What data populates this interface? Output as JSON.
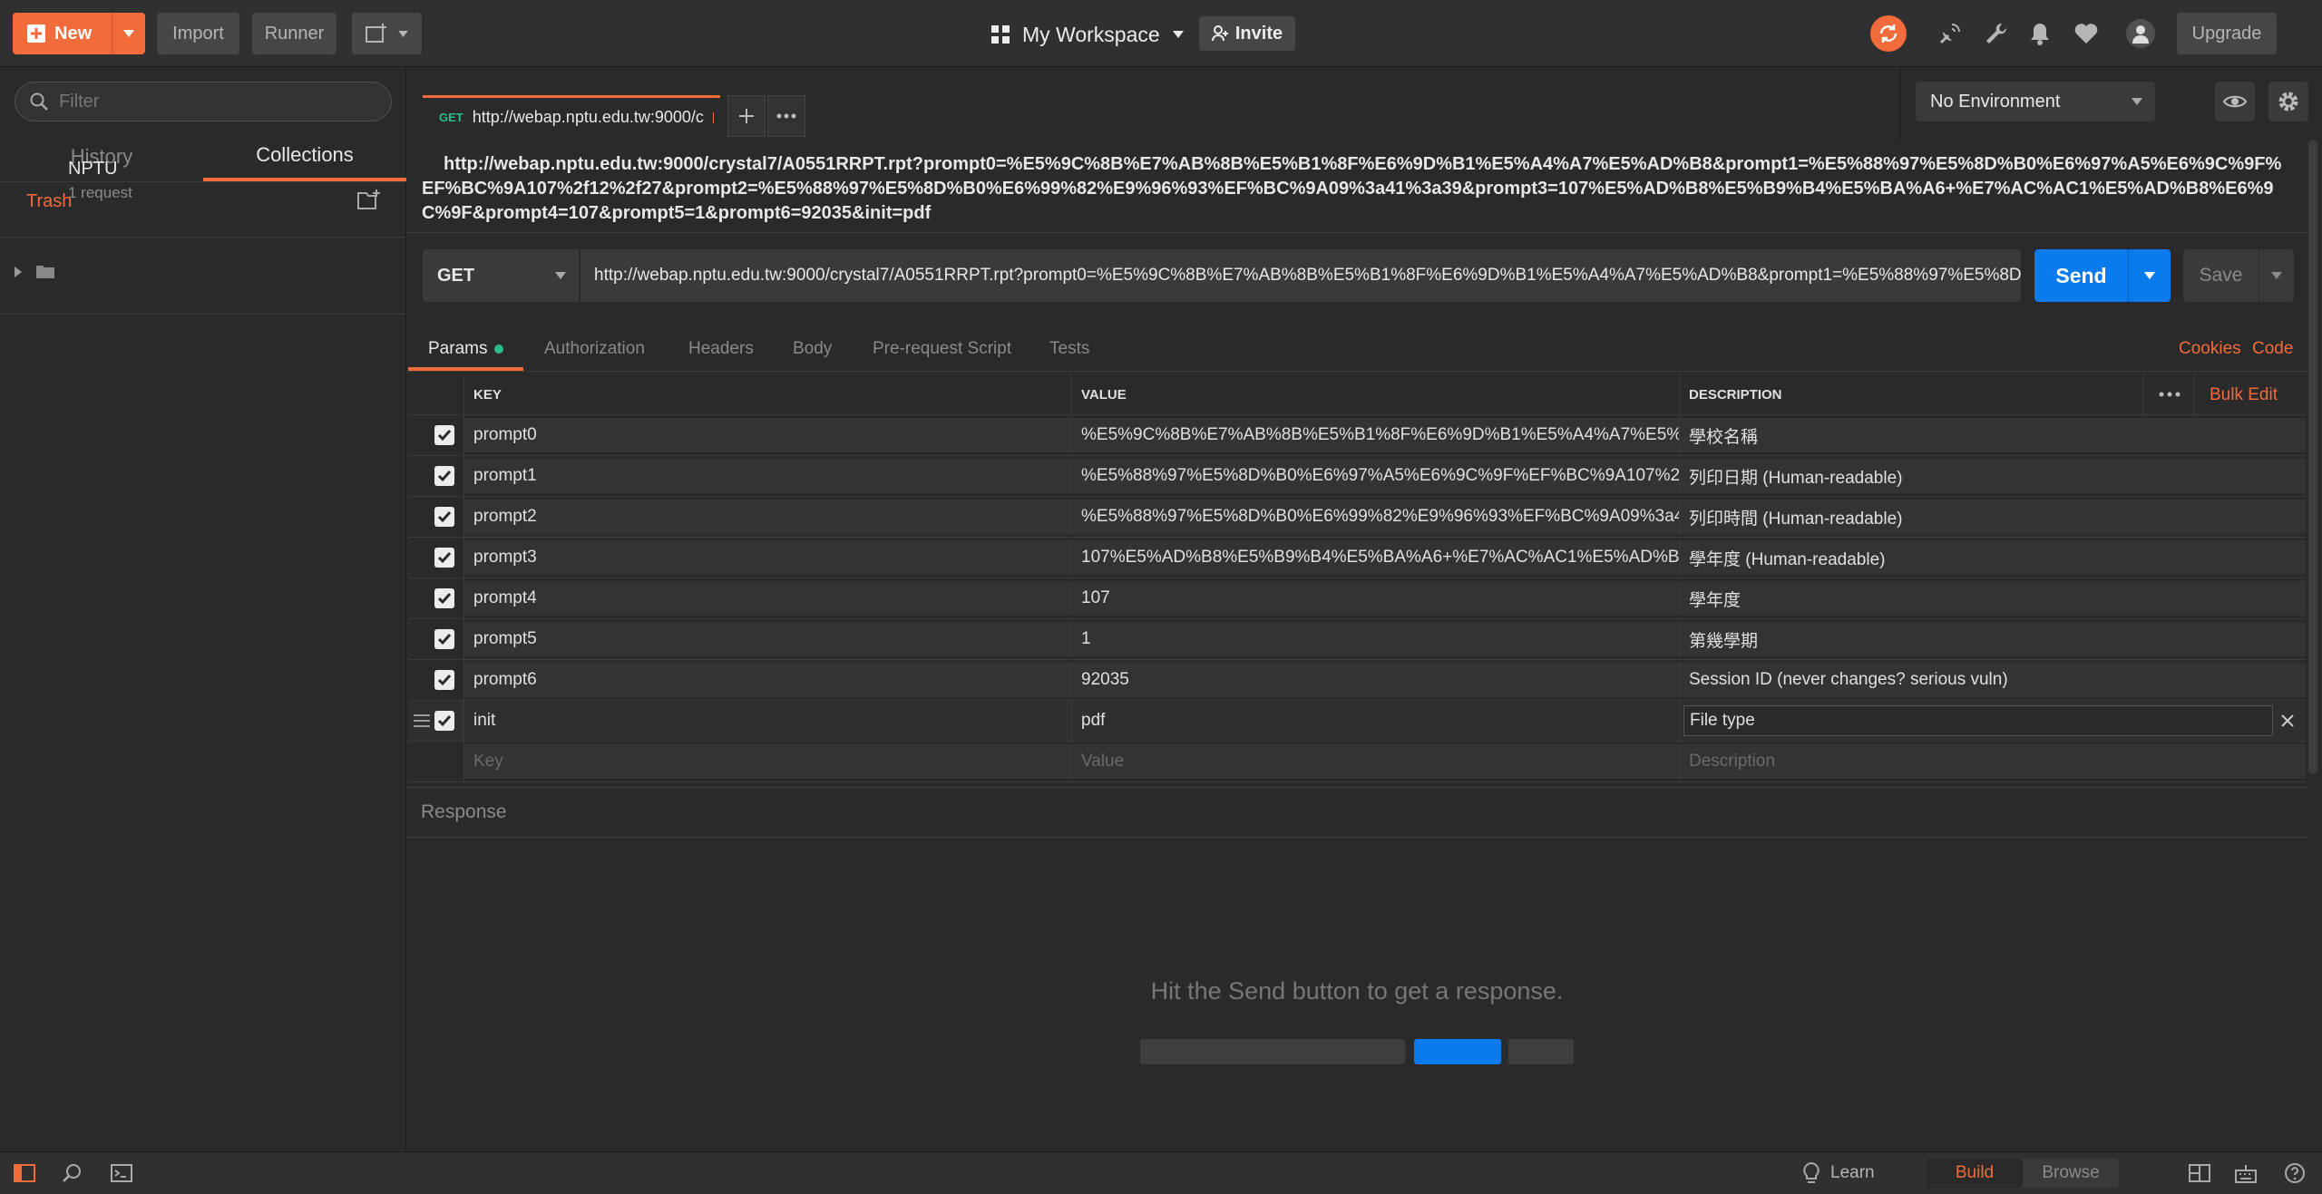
{
  "topbar": {
    "new_label": "New",
    "import_label": "Import",
    "runner_label": "Runner",
    "workspace_label": "My Workspace",
    "invite_label": "Invite",
    "upgrade_label": "Upgrade"
  },
  "sidebar": {
    "filter_placeholder": "Filter",
    "tabs": [
      "History",
      "Collections"
    ],
    "active_tab": "Collections",
    "trash_label": "Trash",
    "collection": {
      "name": "NPTU",
      "count": "1 request"
    }
  },
  "request_tab": {
    "method": "GET",
    "url": "http://webap.nptu.edu.tw:9000/c"
  },
  "environment": {
    "selected": "No Environment"
  },
  "request": {
    "title": "http://webap.nptu.edu.tw:9000/crystal7/A0551RRPT.rpt?prompt0=%E5%9C%8B%E7%AB%8B%E5%B1%8F%E6%9D%B1%E5%A4%A7%E5%AD%B8&prompt1=%E5%88%97%E5%8D%B0%E6%97%A5%E6%9C%9F%EF%BC%9A107%2f12%2f27&prompt2=%E5%88%97%E5%8D%B0%E6%99%82%E9%96%93%EF%BC%9A09%3a41%3a39&prompt3=107%E5%AD%B8%E5%B9%B4%E5%BA%A6+%E7%AC%AC1%E5%AD%B8%E6%9C%9F&prompt4=107&prompt5=1&prompt6=92035&init=pdf",
    "method": "GET",
    "url_display": "http://webap.nptu.edu.tw:9000/crystal7/A0551RRPT.rpt?prompt0=%E5%9C%8B%E7%AB%8B%E5%B1%8F%E6%9D%B1%E5%A4%A7%E5%AD%B8&prompt1=%E5%88%97%E5%8D%B0%...",
    "send_label": "Send",
    "save_label": "Save"
  },
  "request_tabs": {
    "params": "Params",
    "authorization": "Authorization",
    "headers": "Headers",
    "body": "Body",
    "prerequest": "Pre-request Script",
    "tests": "Tests",
    "cookies": "Cookies",
    "code": "Code"
  },
  "params": {
    "headers": {
      "key": "KEY",
      "value": "VALUE",
      "description": "DESCRIPTION",
      "bulk_edit": "Bulk Edit"
    },
    "rows": [
      {
        "key": "prompt0",
        "value": "%E5%9C%8B%E7%AB%8B%E5%B1%8F%E6%9D%B1%E5%A4%A7%E5%AD...",
        "description": "學校名稱"
      },
      {
        "key": "prompt1",
        "value": "%E5%88%97%E5%8D%B0%E6%97%A5%E6%9C%9F%EF%BC%9A107%2f12...",
        "description": "列印日期 (Human-readable)"
      },
      {
        "key": "prompt2",
        "value": "%E5%88%97%E5%8D%B0%E6%99%82%E9%96%93%EF%BC%9A09%3a41%...",
        "description": "列印時間 (Human-readable)"
      },
      {
        "key": "prompt3",
        "value": "107%E5%AD%B8%E5%B9%B4%E5%BA%A6+%E7%AC%AC1%E5%AD%B8%E...",
        "description": "學年度 (Human-readable)"
      },
      {
        "key": "prompt4",
        "value": "107",
        "description": "學年度"
      },
      {
        "key": "prompt5",
        "value": "1",
        "description": "第幾學期"
      },
      {
        "key": "prompt6",
        "value": "92035",
        "description": "Session ID (never changes? serious vuln)"
      },
      {
        "key": "init",
        "value": "pdf",
        "description": "File type"
      }
    ],
    "placeholders": {
      "key": "Key",
      "value": "Value",
      "description": "Description"
    }
  },
  "response": {
    "header": "Response",
    "hint": "Hit the Send button to get a response."
  },
  "statusbar": {
    "learn": "Learn",
    "build": "Build",
    "browse": "Browse"
  },
  "colors": {
    "accent": "#f26b3a",
    "send": "#097bed",
    "param_dot": "#2bbc8a"
  }
}
